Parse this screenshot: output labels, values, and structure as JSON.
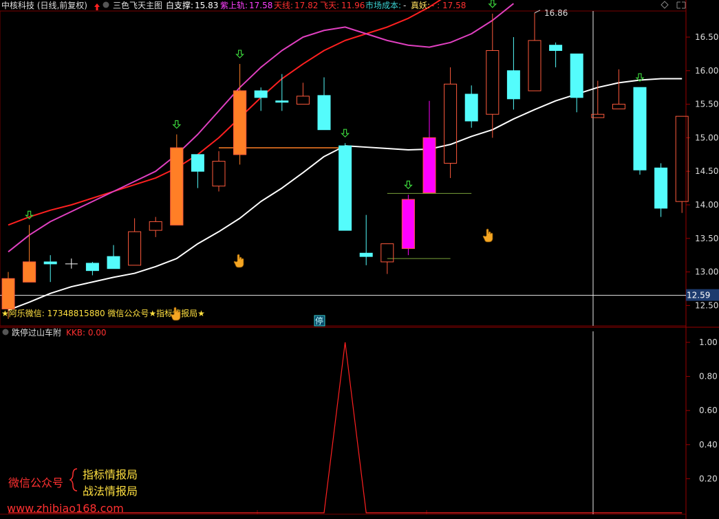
{
  "header": {
    "stock": "中核科技 (日线,前复权)",
    "indicator": "三色飞天主图",
    "bai_label": "白支撑:",
    "bai_value": "15.83",
    "zi_label": "紫上轨:",
    "zi_value": "17.58",
    "tian_label": "天线:",
    "tian_value": "17.82",
    "fei_label": "飞天:",
    "fei_value": "11.96",
    "market_cost_label": "市场成本:",
    "market_cost_value": "-",
    "zhenyao_label": "真妖:",
    "zhenyao_value": "- : 17.58"
  },
  "overlay": {
    "wechat_line": "★阿乐微信: 17348815880    微信公众号★指标情报局★",
    "halt_marker": "停",
    "price_line_label": "12.59",
    "max_label": "16.86"
  },
  "sub": {
    "title": "跌停过山车附",
    "kkb": "KKB: 0.00"
  },
  "watermark": {
    "left": "微信公众号",
    "right1": "指标情报局",
    "right2": "战法情报局",
    "url": "www.zhibiao168.com"
  },
  "colors": {
    "up": "#ff5a3c",
    "down": "#54fcfc",
    "orange": "#ff7f26",
    "magenta": "#ff00ff",
    "white_line": "#ffffff",
    "red_line": "#ff2020",
    "pink_line": "#e040c0",
    "kkb": "#ff2020"
  },
  "chart_data": {
    "type": "candlestick",
    "price_axis": {
      "min": 12.5,
      "max": 16.5,
      "ticks": [
        12.5,
        13.0,
        13.5,
        14.0,
        14.5,
        15.0,
        15.5,
        16.0,
        16.5
      ]
    },
    "candles": [
      {
        "o": 12.45,
        "c": 12.9,
        "h": 13.0,
        "l": 12.3,
        "s": "orange"
      },
      {
        "o": 12.85,
        "c": 13.15,
        "h": 13.7,
        "l": 12.85,
        "s": "orange"
      },
      {
        "o": 13.15,
        "c": 13.12,
        "h": 13.25,
        "l": 12.85,
        "s": "down"
      },
      {
        "o": 13.12,
        "c": 13.12,
        "h": 13.2,
        "l": 13.05,
        "s": "doji"
      },
      {
        "o": 13.13,
        "c": 13.02,
        "h": 13.15,
        "l": 12.95,
        "s": "down"
      },
      {
        "o": 13.23,
        "c": 13.05,
        "h": 13.4,
        "l": 13.05,
        "s": "down"
      },
      {
        "o": 13.1,
        "c": 13.6,
        "h": 13.8,
        "l": 13.1,
        "s": "up"
      },
      {
        "o": 13.62,
        "c": 13.75,
        "h": 13.82,
        "l": 13.52,
        "s": "up"
      },
      {
        "o": 13.7,
        "c": 14.85,
        "h": 15.05,
        "l": 13.7,
        "s": "orange"
      },
      {
        "o": 14.75,
        "c": 14.5,
        "h": 14.75,
        "l": 14.25,
        "s": "down"
      },
      {
        "o": 14.28,
        "c": 14.65,
        "h": 14.8,
        "l": 14.2,
        "s": "up"
      },
      {
        "o": 14.75,
        "c": 15.7,
        "h": 16.1,
        "l": 14.6,
        "s": "orange"
      },
      {
        "o": 15.7,
        "c": 15.6,
        "h": 15.75,
        "l": 15.4,
        "s": "down"
      },
      {
        "o": 15.55,
        "c": 15.53,
        "h": 15.95,
        "l": 15.4,
        "s": "down"
      },
      {
        "o": 15.5,
        "c": 15.62,
        "h": 15.82,
        "l": 15.5,
        "s": "up"
      },
      {
        "o": 15.63,
        "c": 15.12,
        "h": 15.9,
        "l": 15.12,
        "s": "down"
      },
      {
        "o": 14.88,
        "c": 13.62,
        "h": 14.92,
        "l": 13.62,
        "s": "down"
      },
      {
        "o": 13.28,
        "c": 13.23,
        "h": 13.85,
        "l": 13.1,
        "s": "down"
      },
      {
        "o": 13.15,
        "c": 13.42,
        "h": 13.42,
        "l": 12.97,
        "s": "up"
      },
      {
        "o": 13.35,
        "c": 14.08,
        "h": 14.15,
        "l": 13.25,
        "s": "magenta"
      },
      {
        "o": 14.18,
        "c": 15.0,
        "h": 15.55,
        "l": 14.18,
        "s": "magenta"
      },
      {
        "o": 14.62,
        "c": 15.8,
        "h": 16.05,
        "l": 14.4,
        "s": "up"
      },
      {
        "o": 15.65,
        "c": 15.25,
        "h": 15.78,
        "l": 15.15,
        "s": "down"
      },
      {
        "o": 15.35,
        "c": 16.3,
        "h": 16.85,
        "l": 15.0,
        "s": "up"
      },
      {
        "o": 16.0,
        "c": 15.58,
        "h": 16.5,
        "l": 15.42,
        "s": "down"
      },
      {
        "o": 15.7,
        "c": 16.45,
        "h": 16.86,
        "l": 15.7,
        "s": "up"
      },
      {
        "o": 16.38,
        "c": 16.3,
        "h": 16.42,
        "l": 16.05,
        "s": "down"
      },
      {
        "o": 16.25,
        "c": 15.6,
        "h": 16.25,
        "l": 15.38,
        "s": "down"
      },
      {
        "o": 15.3,
        "c": 15.35,
        "h": 15.85,
        "l": 15.3,
        "s": "up"
      },
      {
        "o": 15.43,
        "c": 15.5,
        "h": 16.02,
        "l": 15.43,
        "s": "up"
      },
      {
        "o": 15.75,
        "c": 14.52,
        "h": 15.75,
        "l": 14.45,
        "s": "down"
      },
      {
        "o": 14.55,
        "c": 13.95,
        "h": 14.62,
        "l": 13.82,
        "s": "down"
      },
      {
        "o": 14.05,
        "c": 15.32,
        "h": 15.32,
        "l": 13.88,
        "s": "up"
      }
    ],
    "white_line": [
      12.43,
      12.55,
      12.68,
      12.78,
      12.85,
      12.92,
      12.98,
      13.08,
      13.2,
      13.42,
      13.6,
      13.8,
      14.05,
      14.25,
      14.48,
      14.72,
      14.88,
      14.86,
      14.84,
      14.82,
      14.83,
      14.9,
      15.02,
      15.12,
      15.28,
      15.42,
      15.55,
      15.65,
      15.75,
      15.82,
      15.86,
      15.88,
      15.88
    ],
    "red_line": [
      13.7,
      13.82,
      13.92,
      14.0,
      14.1,
      14.2,
      14.3,
      14.4,
      14.55,
      14.75,
      15.0,
      15.3,
      15.6,
      15.88,
      16.1,
      16.3,
      16.45,
      16.55,
      16.65,
      16.78,
      16.95,
      17.15,
      17.35,
      17.55
    ],
    "pink_line": [
      13.3,
      13.55,
      13.75,
      13.9,
      14.05,
      14.2,
      14.35,
      14.5,
      14.75,
      15.05,
      15.4,
      15.75,
      16.05,
      16.3,
      16.5,
      16.6,
      16.65,
      16.55,
      16.45,
      16.38,
      16.35,
      16.42,
      16.55,
      16.75,
      17.0
    ],
    "support_line_orange": {
      "from": 10,
      "to": 16,
      "value": 14.85
    },
    "support_lines_green": [
      {
        "from": 18,
        "to": 22,
        "value": 14.17
      },
      {
        "from": 18,
        "to": 21,
        "value": 13.2
      }
    ],
    "arrows": [
      1,
      8,
      11,
      16,
      19,
      23,
      30
    ],
    "sub_axis": {
      "min": 0,
      "max": 1.0,
      "ticks": [
        0.2,
        0.4,
        0.6,
        0.8,
        1.0
      ]
    },
    "kkb": [
      0,
      0,
      0,
      0,
      0,
      0,
      0,
      0,
      0,
      0,
      0,
      0,
      0,
      0,
      0,
      0,
      1,
      0,
      0,
      0,
      0,
      0,
      0,
      0,
      0,
      0,
      0,
      0,
      0,
      0,
      0,
      0,
      0
    ]
  }
}
